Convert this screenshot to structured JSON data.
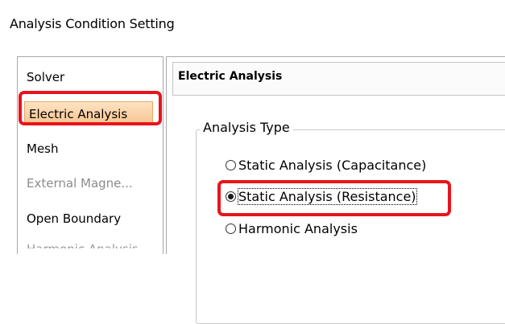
{
  "window": {
    "title": "Analysis Condition Setting"
  },
  "sidebar": {
    "items": [
      {
        "label": "Solver",
        "state": "normal"
      },
      {
        "label": "Electric Analysis",
        "state": "selected"
      },
      {
        "label": "Mesh",
        "state": "normal"
      },
      {
        "label": "External Magne...",
        "state": "disabled"
      },
      {
        "label": "Open Boundary",
        "state": "normal"
      },
      {
        "label": "Harmonic Analysis",
        "state": "disabled"
      }
    ]
  },
  "panel": {
    "header": "Electric Analysis",
    "analysis_type": {
      "title": "Analysis Type",
      "options": [
        {
          "label": "Static Analysis (Capacitance)",
          "checked": false
        },
        {
          "label": "Static Analysis (Resistance)",
          "checked": true
        },
        {
          "label": "Harmonic Analysis",
          "checked": false
        }
      ]
    }
  },
  "colors": {
    "highlight": "#e8141c",
    "selected_bg": "#f8c48e",
    "disabled_text": "#8c8c8c"
  }
}
